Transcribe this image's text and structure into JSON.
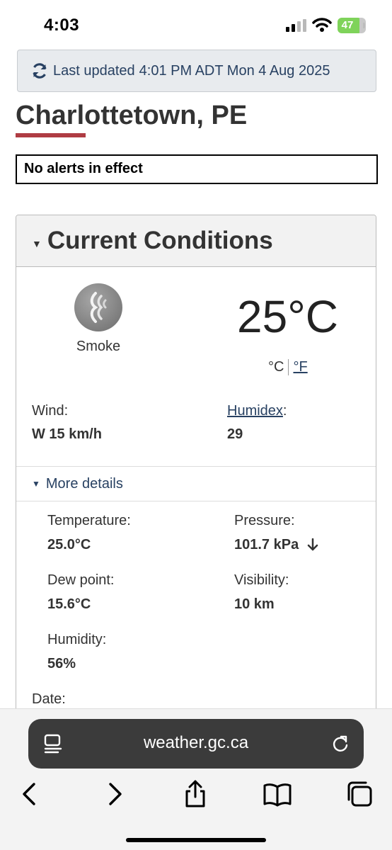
{
  "status_bar": {
    "time": "4:03",
    "battery": "47"
  },
  "last_updated": {
    "label": "Last updated",
    "value": "4:01 PM ADT Mon 4 Aug 2025"
  },
  "page": {
    "city": "Charlottetown, PE",
    "alerts": "No alerts in effect"
  },
  "current_conditions": {
    "title": "Current Conditions",
    "condition": "Smoke",
    "icon": "smoke-icon",
    "temperature": "25°C",
    "unit_c": "°C",
    "unit_f": "°F",
    "wind_label": "Wind:",
    "wind_value": "W 15 km/h",
    "humidex_label": "Humidex",
    "humidex_colon": ":",
    "humidex_value": "29",
    "more_details": "More details",
    "temperature_label": "Temperature:",
    "temperature_value": "25.0°C",
    "pressure_label": "Pressure:",
    "pressure_value": "101.7 kPa",
    "pressure_trend": "falling",
    "dew_point_label": "Dew point:",
    "dew_point_value": "15.6°C",
    "visibility_label": "Visibility:",
    "visibility_value": "10 km",
    "humidity_label": "Humidity:",
    "humidity_value": "56%",
    "date_label": "Date:"
  },
  "browser": {
    "url": "weather.gc.ca"
  },
  "colors": {
    "link": "#284162",
    "accent_rule": "#af3c43",
    "battery": "#7fd35a"
  }
}
